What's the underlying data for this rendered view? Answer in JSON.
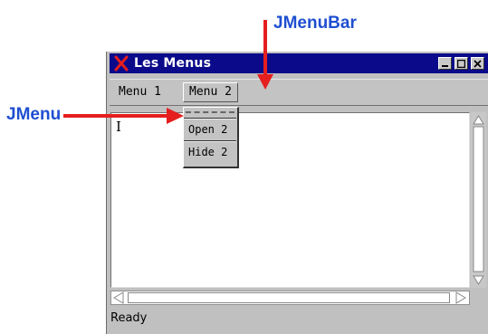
{
  "annotations": {
    "menubar_label": "JMenuBar",
    "menu_label": "JMenu",
    "arrow_color": "#e51e1e",
    "label_color": "#1f4fd1"
  },
  "window": {
    "title": "Les Menus",
    "title_icon": "x-logo-icon",
    "controls": [
      "minimize-icon",
      "maximize-icon",
      "close-icon"
    ]
  },
  "menubar": {
    "items": [
      {
        "label": "Menu 1"
      },
      {
        "label": "Menu 2"
      }
    ]
  },
  "popup": {
    "items": [
      {
        "label": "Open 2"
      },
      {
        "label": "Hide 2"
      }
    ]
  },
  "editor": {
    "caret": "I"
  },
  "status": {
    "text": "Ready"
  }
}
